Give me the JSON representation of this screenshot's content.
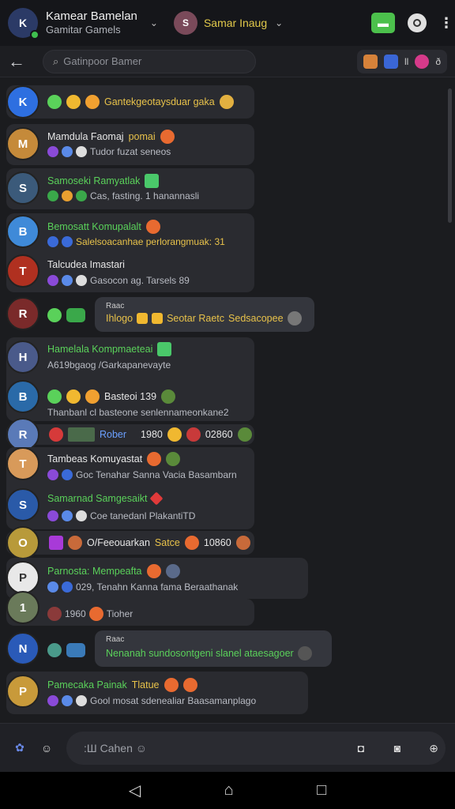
{
  "header": {
    "account_name": "Kamear Bamelan",
    "account_subtitle": "Gamitar Gamels",
    "account_avatar": "K",
    "caret": "⌄",
    "peer_name": "Samar Inaug",
    "peer_caret": "⌄",
    "peer_avatar": "S",
    "menu": "⋮"
  },
  "toolbar": {
    "back": "←",
    "search_placeholder": "Gatinpoor Bamer",
    "tool_1": "O",
    "tool_2": "O",
    "tool_3_text": "ll",
    "tool_4": "O",
    "tool_5_text": "ð"
  },
  "messages": [
    {
      "avatar": "K",
      "color": "#2e6fe0",
      "line1": "Gantekgeotaysduar gaka",
      "emojis": "🙂",
      "type": "single"
    },
    {
      "avatar": "M",
      "color": "#c58a3a",
      "name": "Mamdula Faomaj",
      "tag": "pomai",
      "line2": "Tudor fuzat seneos",
      "type": "two"
    },
    {
      "avatar": "S",
      "color": "#3b5a7a",
      "name": "Samoseki Ramyatlak",
      "line2": "Cas, fasting. 1 hanannasli",
      "type": "two"
    },
    {
      "avatar": "B",
      "color": "#3f8ad8",
      "name": "Bemosatt Komupalalt",
      "line2": "Salelsoacanhae perlorangmuak: 31",
      "type": "two"
    },
    {
      "avatar": "T",
      "color": "#b03020",
      "name": "Talcudea Imastari",
      "line2": "Gasocon ag. Tarsels 89",
      "type": "two"
    },
    {
      "avatar": "R",
      "color": "#7a2a2a",
      "quote_title": "Raac",
      "quote_a": "Ihlogo",
      "quote_b": "Seotar Raetc",
      "quote_c": "Sedsacopee",
      "type": "quote"
    },
    {
      "avatar": "H",
      "color": "#4a5a8a",
      "name": "Hamelala Kompmaeteai",
      "line2": "A619bgaog /Garkapanevayte",
      "type": "two"
    },
    {
      "avatar": "B",
      "color": "#2a6aa8",
      "name_a": "Basteoi 139",
      "line2": "Thanbanl cl basteone senlennameonkane2",
      "type": "two-b"
    },
    {
      "avatar": "R",
      "color": "#5a7ab8",
      "badge": "Rober",
      "num": "1980",
      "num2": "02860",
      "type": "badge"
    },
    {
      "avatar": "T",
      "color": "#d89a5a",
      "name": "Tambeas Komuyastat",
      "line2": "Goc Tenahar Sanna Vacia Basambarn",
      "type": "two"
    },
    {
      "avatar": "S",
      "color": "#2a5aa8",
      "name": "Samarnad Samgesaikt",
      "line2": "Coe tanedanl PlakantiTD",
      "type": "two"
    },
    {
      "avatar": "O",
      "color": "#b89a3a",
      "name": "O/Feeouarkan",
      "tag": "Satce",
      "num": "10860",
      "type": "single-b"
    },
    {
      "avatar": "P",
      "color": "#e8e8e8",
      "name": "Parnosta: Mempeafta",
      "line2": "029, Tenahn Kanna fama Beraathanak",
      "type": "two"
    },
    {
      "avatar": "1",
      "color": "#6a7a5a",
      "line2": "1960",
      "name": "Tioher",
      "type": "single-c"
    },
    {
      "avatar": "N",
      "color": "#2a5ab8",
      "quote_title": "Raac",
      "quote_a": "Nenanah sundosontgeni slanel ataesagoer",
      "type": "quote2"
    },
    {
      "avatar": "P",
      "color": "#c89a3a",
      "name": "Pamecaka Painak",
      "tag": "Tlatue",
      "line2": "Gool mosat sdenealiar Baasamanplago",
      "type": "two"
    }
  ],
  "composer": {
    "placeholder": ":Ш Cahen ☺",
    "left_icon": "✿",
    "emoji_icon": "☺",
    "right_1": "◘",
    "right_2": "◙",
    "right_3": "⊕"
  },
  "navbar": {
    "back": "◁",
    "home": "⌂",
    "recents": "□"
  }
}
